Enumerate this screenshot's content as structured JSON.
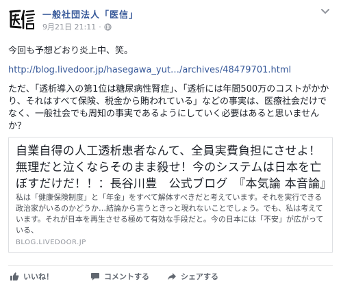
{
  "page": {
    "name": "一般社団法人「医信」",
    "date": "9月21日 21:11",
    "separator": "·"
  },
  "post": {
    "line1": "今回も予想どおり炎上中、笑。",
    "link": "http://blog.livedoor.jp/hasegawa_yut…/archives/48479701.html",
    "para3": "ただ、「透析導入の第1位は糖尿病性腎症」、「透析には年間500万のコストがかかり、それはすべて保険、税金から賄われている」などの事実は、医療社会だけでなく、一般社会でも周知の事実であるようにしていく必要はあると思いませんか？"
  },
  "card": {
    "title": "自業自得の人工透析患者なんて、全員実費負担にさせよ！無理だと泣くならそのまま殺せ！今のシステムは日本を亡ぼすだけだ！！：長谷川豊　公式ブログ　『本気論 本音論』",
    "description": "私は「健康保険制度」と「年金」をすべて解体すべきだと考えています。それを実行できる政治家がいるのかどうか…結論から言うときっと現れないことでしょう。でも、私は考えています。それが日本を再生させる極めて有効な手段だと。今の日本には「不安」が広がっている、",
    "domain": "BLOG.LIVEDOOR.JP"
  },
  "actions": {
    "like": "いいね！",
    "comment": "コメントする",
    "share": "シェアする"
  },
  "icons": {
    "globe": "globe-icon",
    "chevron": "chevron-down-icon",
    "like": "thumbs-up-icon",
    "comment": "comment-icon",
    "share": "share-icon"
  },
  "colors": {
    "link": "#365899",
    "meta": "#90949c",
    "text": "#1d2129",
    "action": "#616770"
  }
}
